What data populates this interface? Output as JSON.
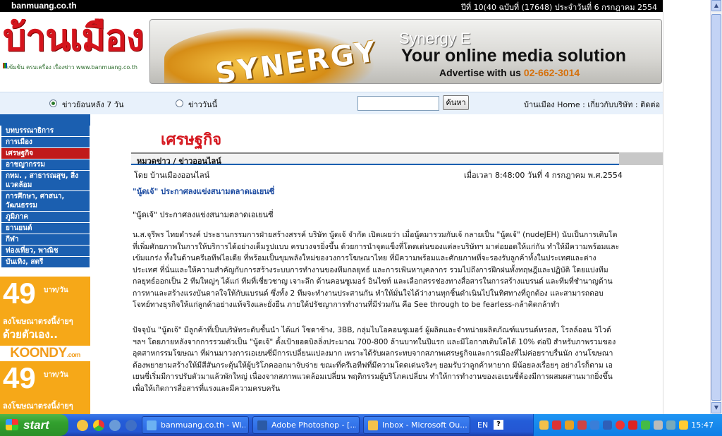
{
  "site": {
    "domain": "banmuang.co.th",
    "issue_info": "ปีที่ 10(40 ฉบับที่ (17648) ประจำวันที่ 6 กรกฎาคม 2554",
    "logo_text": "บ้านเมือง",
    "logo_tagline": "เข้มข้น ครบเครื่อง เรื่องข่าว www.banmuang.co.th"
  },
  "banner": {
    "brand_word": "SYNERGY",
    "line1": "Synergy E",
    "line2": "Your online media solution",
    "line3_prefix": "Advertise with us",
    "phone": "02-662-3014"
  },
  "search": {
    "radio1_label": "ข่าวย้อนหลัง 7 วัน",
    "radio2_label": "ข่าววันนี้",
    "input_value": "",
    "button_label": "ค้นหา",
    "top_links": "บ้านเมือง Home : เกี่ยวกับบริษัท : ติดต่อ"
  },
  "nav": {
    "items": [
      {
        "label": "บทบรรณาธิการ"
      },
      {
        "label": "การเมือง"
      },
      {
        "label": "เศรษฐกิจ"
      },
      {
        "label": "อาชญากรรม"
      },
      {
        "label": "กทม. , สาธารณสุข, สิ่งแวดล้อม"
      },
      {
        "label": "การศึกษา, ศาสนา, วัฒนธรรม"
      },
      {
        "label": "ภูมิภาค"
      },
      {
        "label": "ยานยนต์"
      },
      {
        "label": "กีฬา"
      },
      {
        "label": "ท่องเที่ยว, พาณิช"
      },
      {
        "label": "บันเทิง, สตรี"
      }
    ],
    "active_index": 2
  },
  "ads": {
    "price": "49",
    "unit": "บาท/วัน",
    "promo": "ลงโฆษณาตรงนี้ง่ายๆ",
    "diy": "ด้วยตัวเอง..",
    "brand": "KOONDY",
    "brand_suffix": ".com"
  },
  "article": {
    "section_title": "เศรษฐกิจ",
    "category": "หมวดข่าว / ข่าวออนไลน์",
    "byline": "โดย บ้านเมืองออนไลน์",
    "datetime": "เมื่อเวลา 8:48:00 วันที่ 4 กรกฎาคม พ.ศ.2554",
    "headline": "\"นู้ดเจ้\" ประกาศลงแข่งสนามตลาดเอเยนซี่",
    "subhead": "\"นู้ดเจ้\" ประกาศลงแข่งสนามตลาดเอเยนซี่",
    "para1": "น.ส.จุรีพร ไทยดำรงค์ ประธานกรรมการฝ่ายสร้างสรรค์ บริษัท นู้ดเจ้ จำกัด เปิดเผยว่า เมื่อนู้ดมารวมกับเจ้ กลายเป็น \"นู้ดเจ้\" (nudeJEH) นับเป็นการเติบโตที่เพิ่มศักยภาพในการให้บริการได้อย่างเต็มรูปแบบ ครบวงจรยิ่งขึ้น ด้วยการนำจุดแข็งที่โดดเด่นของแต่ละบริษัทฯ มาต่อยอดให้แก่กัน ทำให้มีความพร้อมและเข้มแกร่ง ทั้งในด้านครีเอทีฟไอเดีย ที่พร้อมเป็นขุมพลังใหม่ของวงการโฆษณาไทย ที่มีความพร้อมและศักยภาพที่จะรองรับลูกค้าทั้งในประเทศและต่างประเทศ ที่นั่นและให้ความสำคัญกับการสร้างระบบการทำงานของทีมกลยุทธ์ และการเฟ้นหาบุคลากร รวมไปถึงการฝึกฝนทั้งทฤษฎีและปฏิบัติ โดยแบ่งทีมกลยุทธ์ออกเป็น 2 ทีมใหญ่ๆ ได้แก่ ทีมที่เชี่ยวชาญ เจาะลึก ด้านคอนซูเมอร์ อินไซท์ และเลือกสรรช่องทางสื่อสารในการสร้างแบรนด์ และทีมที่ชำนาญด้านการหาและสร้างแรงบันดาลใจให้กับแบรนด์ ซึ่งทั้ง 2 ทีมจะทำงานประสานกัน ทำให้มั่นใจได้ว่างานทุกชิ้นดำเนินไปในทิศทางที่ถูกต้อง และสามารถตอบโจทย์ทางธุรกิจให้แก่ลูกค้าอย่างแท้จริงและยั่งยืน ภายใต้ปรัชญาการทำงานที่มีร่วมกัน คือ See through to be fearless-กล้าคิดกล้าทำ",
    "para2": "ปัจจุบัน \"นู้ดเจ้\" มีลูกค้าที่เป็นบริษัทระดับชั้นนำ ได้แก่ โซดาช้าง, 3BB, กลุ่มไบโอคอนซูเมอร์ ผู้ผลิตและจำหน่ายผลิตภัณฑ์แบรนด์ทรอส, โรลล์ออน วิไวต์ ฯลฯ โดยภายหลังจากการรวมตัวเป็น \"นู้ดเจ้\" ตั้งเป้ายอดบิลลิ่งประมาณ 700-800 ล้านบาทในปีแรก และมีโอกาสเติบโตได้ 10% ต่อปี สำหรับภาพรวมของอุตสาหกรรมโฆษณา ที่ผ่านมาวงการเอเยนซี่มีการเปลี่ยนแปลงมาก เพราะได้รับผลกระทบจากสภาพเศรษฐกิจและการเมืองที่ไม่ค่อยราบรื่นนัก งานโฆษณาต้องพยายามสร้างให้มีสีสันกระตุ้นให้ผู้บริโภคออกมาจับจ่าย ขณะที่ครีเอทีฟที่มีความโดดเด่นจริงๆ ยอมรับว่าลูกค้าหายาก มีน้อยลงเรื่อยๆ อย่างไรก็ตาม เอเยนซี่เริ่มมีการปรับตัวมาแล้วพักใหญ่ เนื่องจากสภาพแวดล้อมเปลี่ยน พฤติกรรมผู้บริโภคเปลี่ยน ทำให้การทำงานของเอเยนซี่ต้องมีการผสมผสานมากยิ่งขึ้น เพื่อให้เกิดการสื่อสารที่แรงและมีความครบครัน"
  },
  "taskbar": {
    "start_label": "start",
    "tasks": [
      {
        "label": "banmuang.co.th - Wi..."
      },
      {
        "label": "Adobe Photoshop - [..."
      },
      {
        "label": "Inbox - Microsoft Ou..."
      }
    ],
    "lang": "EN",
    "help": "?",
    "clock": "15:47"
  },
  "colors": {
    "nav_blue": "#1b5fb0",
    "nav_active": "#c01a1a",
    "title_red": "#d5171f",
    "ad_orange": "#f6a818"
  }
}
